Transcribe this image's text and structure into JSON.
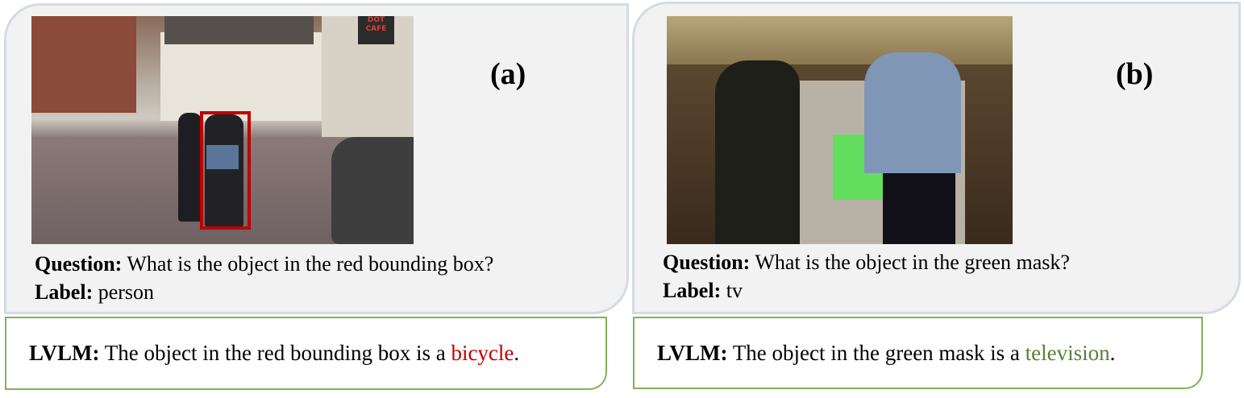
{
  "panels": [
    {
      "tag": "(a)",
      "question_label": "Question:",
      "question": "What is the object in the red bounding box?",
      "label_label": "Label:",
      "label": "person",
      "answer_prefix": "LVLM:",
      "answer_text": "The object in the red bounding box is a",
      "answer_highlight": "bicycle",
      "answer_end": ".",
      "highlight_color": "#c00000",
      "annotation": "red bounding box",
      "photo_sign": "DOT CAFE"
    },
    {
      "tag": "(b)",
      "question_label": "Question:",
      "question": "What is the object in the green mask?",
      "label_label": "Label:",
      "label": "tv",
      "answer_prefix": "LVLM:",
      "answer_text": "The object in the green mask is a",
      "answer_highlight": "television",
      "answer_end": ".",
      "highlight_color": "#548235",
      "annotation": "green mask"
    }
  ],
  "colors": {
    "panel_bg": "#f2f2f2",
    "panel_border": "#d4dbe6",
    "answer_border": "#7fb356",
    "bbox": "#c00000",
    "mask": "#5fe05a"
  }
}
